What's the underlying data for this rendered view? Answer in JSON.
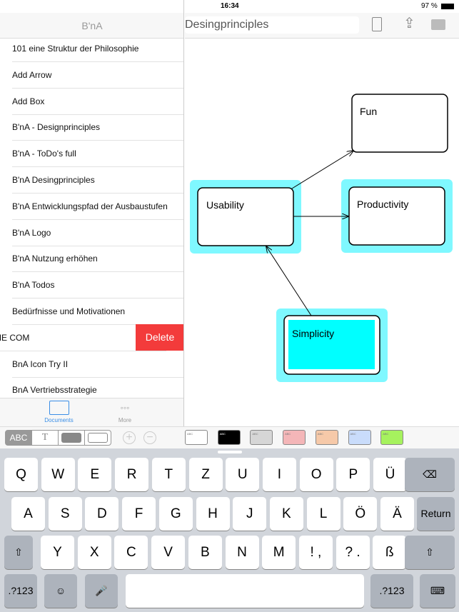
{
  "status": {
    "device": "iPad",
    "time": "16:34",
    "battery": "97 %"
  },
  "sidebar": {
    "title": "B'nA",
    "items": [
      "101 eine Struktur der Philosophie",
      "Add Arrow",
      "Add Box",
      "B'nA - Designprinciples",
      "B'nA - ToDo's full",
      "B'nA Desingprinciples",
      "B'nA Entwicklungspfad der Ausbaustufen",
      "B'nA Logo",
      "B'nA Nutzung erhöhen",
      "B'nA Todos",
      "Bedürfnisse und Motivationen",
      "ME COM",
      "BnA Icon Try II",
      "BnA Vertriebsstrategie"
    ],
    "delete_label": "Delete",
    "tabs": [
      {
        "label": "Documents",
        "icon": "folder-icon",
        "active": true
      },
      {
        "label": "More",
        "icon": "more-icon"
      }
    ]
  },
  "header": {
    "doc_title": "Desingprinciples",
    "icons": [
      "clipboard-icon",
      "share-icon",
      "camera-icon"
    ]
  },
  "diagram": {
    "nodes": [
      "Fun",
      "Usability",
      "Productivity",
      "Simplicity"
    ],
    "highlight": "#7ff8ff",
    "fill_simplicity": "#00ffff"
  },
  "toolbar": {
    "segments": [
      "ABC",
      "T"
    ],
    "swatch_label": "ABC",
    "swatches": [
      "#ffffff",
      "#000000",
      "#d6d6d6",
      "#f4b6b8",
      "#f6c9a9",
      "#c9dcfb",
      "#a6f25e"
    ]
  },
  "keyboard": {
    "row1": [
      "Q",
      "W",
      "E",
      "R",
      "T",
      "Z",
      "U",
      "I",
      "O",
      "P",
      "Ü"
    ],
    "row2": [
      "A",
      "S",
      "D",
      "F",
      "G",
      "H",
      "J",
      "K",
      "L",
      "Ö",
      "Ä"
    ],
    "row3": [
      "Y",
      "X",
      "C",
      "V",
      "B",
      "N",
      "M",
      "!\n,",
      "?\n.",
      " ß"
    ],
    "return": "Return",
    "num": ".?123"
  }
}
